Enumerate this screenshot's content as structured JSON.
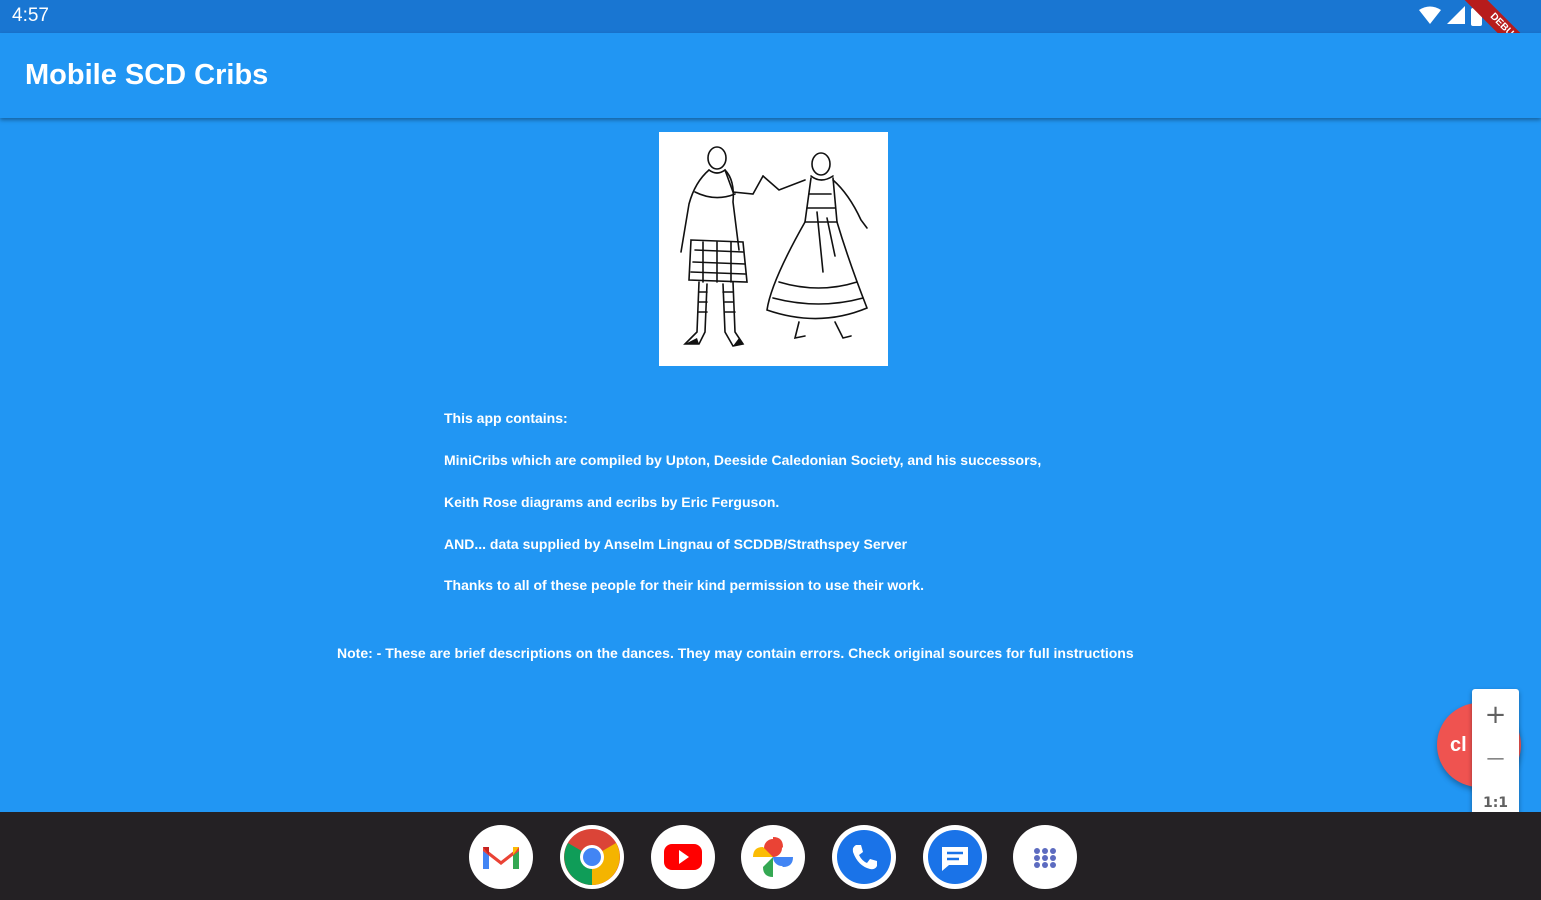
{
  "status_bar": {
    "time": "4:57",
    "debug_label": "DEBUG"
  },
  "app_bar": {
    "title": "Mobile SCD Cribs"
  },
  "content": {
    "lines": [
      "This app contains:",
      " MiniCribs which are compiled by Upton, Deeside Caledonian Society, and his successors,",
      "Keith Rose diagrams and ecribs by Eric Ferguson.",
      " AND... data supplied by Anselm Lingnau of SCDDB/Strathspey Server",
      "Thanks to all of these people for their kind permission to use their work."
    ],
    "note": "Note: - These are brief descriptions on the dances. They may contain errors. Check original sources for full instructions"
  },
  "fab": {
    "label": "cl"
  },
  "zoom": {
    "plus": "+",
    "minus": "—",
    "reset": "1:1"
  },
  "dock": {
    "apps": [
      "gmail",
      "chrome",
      "youtube",
      "photos",
      "phone",
      "messages",
      "app-drawer"
    ]
  },
  "colors": {
    "primary": "#2196F3",
    "status_bar": "#1976D2",
    "fab": "#EF5350",
    "taskbar": "#242124"
  }
}
